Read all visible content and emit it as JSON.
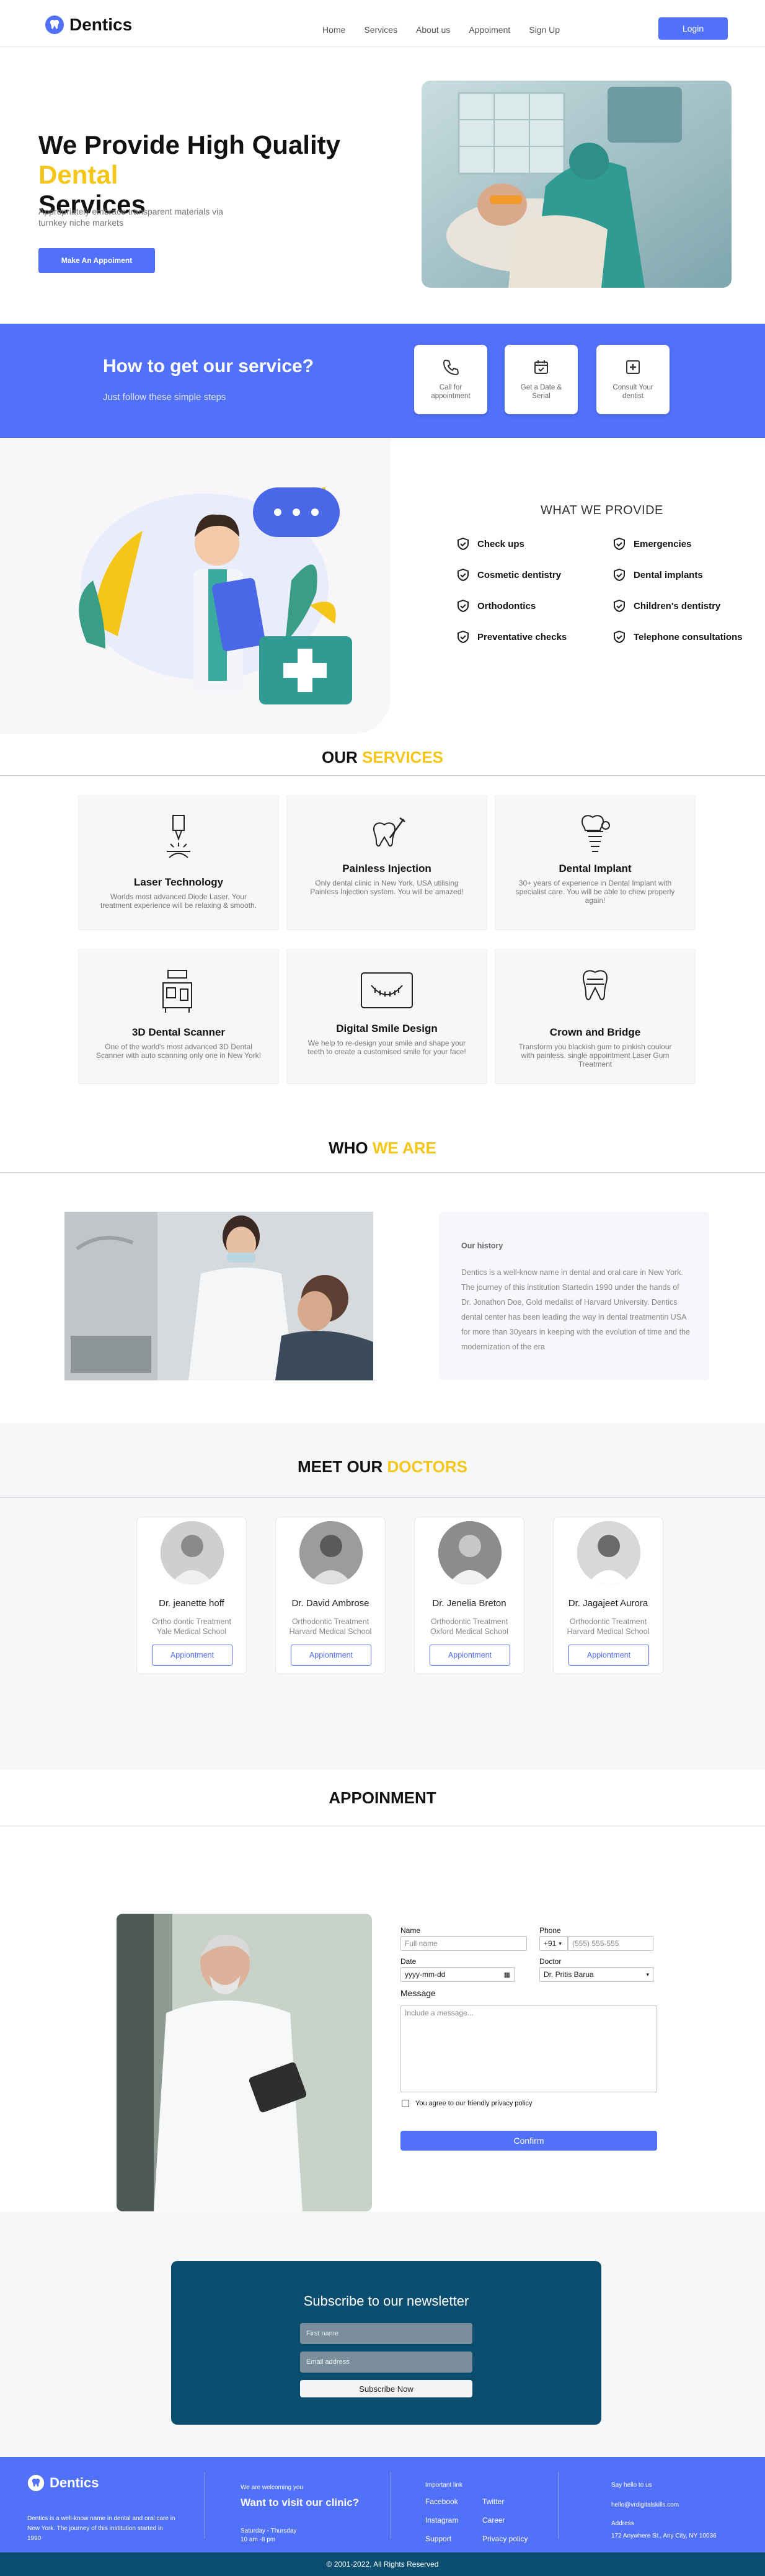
{
  "nav": {
    "brand": "Dentics",
    "links": [
      "Home",
      "Services",
      "About us",
      "Appoiment",
      "Sign Up"
    ],
    "login": "Login"
  },
  "hero": {
    "title_part1": "We Provide High Quality",
    "title_accent": "Dental",
    "title_part2": "Services",
    "subtitle": "Appropriately embrace transparent materials via turnkey niche markets",
    "button": "Make An Appoiment"
  },
  "how": {
    "title": "How to get our service?",
    "subtitle": "Just follow these simple steps",
    "steps": [
      "Call for appointment",
      "Get a Date & Serial",
      "Consult Your dentist"
    ]
  },
  "provide": {
    "title": "WHAT WE PROVIDE",
    "items": [
      "Check ups",
      "Emergencies",
      "Cosmetic dentistry",
      "Dental implants",
      "Orthodontics",
      "Children's dentistry",
      "Preventative checks",
      "Telephone consultations"
    ]
  },
  "services": {
    "heading": "OUR",
    "heading_accent": "SERVICES",
    "items": [
      {
        "title": "Laser Technology",
        "desc": "Worlds most advanced Diode Laser. Your treatment experience will be relaxing & smooth."
      },
      {
        "title": "Painless Injection",
        "desc": "Only dental clinic in New York, USA utilising Painless Injection system. You will be amazed!"
      },
      {
        "title": "Dental Implant",
        "desc": "30+ years of experience in Dental Implant with specialist care. You will be able to chew properly again!"
      },
      {
        "title": "3D Dental Scanner",
        "desc": "One of the world's most advanced 3D Dental Scanner with auto scanning only one in New York!"
      },
      {
        "title": "Digital Smile Design",
        "desc": "We help to re-design your smile and shape your teeth to create a customised smile for your face!"
      },
      {
        "title": "Crown and Bridge",
        "desc": "Transform you blackish gum to pinkish coulour with painless. single appointment Laser Gum Treatment"
      }
    ]
  },
  "who": {
    "heading": "WHO",
    "heading_accent": "WE ARE",
    "history_title": "Our history",
    "history_text": "Dentics is a well-know name in dental and oral care in New York. The journey of this institution Startedin 1990 under the hands of Dr. Jonathon Doe, Gold medalist of Harvard University. Dentics dental center has been leading the way in dental treatmentin USA for more than 30years in keeping with the evolution of time and the modernization of the era"
  },
  "doctors": {
    "heading": "MEET OUR",
    "heading_accent": "DOCTORS",
    "button": "Appiontment",
    "items": [
      {
        "name": "Dr. jeanette hoff",
        "role": "Ortho dontic Treatment Yale Medical School"
      },
      {
        "name": "Dr. David Ambrose",
        "role": "Orthodontic Treatment Harvard Medical School"
      },
      {
        "name": "Dr. Jenelia Breton",
        "role": "Orthodontic Treatment Oxford Medical School"
      },
      {
        "name": "Dr. Jagajeet Aurora",
        "role": "Orthodontic Treatment Harvard Medical School"
      }
    ]
  },
  "appointment": {
    "heading": "APPOINMENT",
    "name_label": "Name",
    "name_placeholder": "Full name",
    "phone_label": "Phone",
    "phone_code": "+91",
    "phone_placeholder": "(555) 555-555",
    "date_label": "Date",
    "date_placeholder": "yyyy-mm-dd",
    "doctor_label": "Doctor",
    "doctor_value": "Dr. Pritis Barua",
    "message_label": "Message",
    "message_placeholder": "Include a message...",
    "agree": "You agree to our friendly privacy policy",
    "confirm": "Confirm"
  },
  "newsletter": {
    "title": "Subscribe to our newsletter",
    "first_name": "First name",
    "email": "Email address",
    "button": "Subscribe Now"
  },
  "footer": {
    "brand": "Dentics",
    "about": "Dentics is a well-know name in dental and oral care in New York. The journey of this institution started in 1990",
    "welcome": "We are welcoming you",
    "visit_title": "Want to visit our clinic?",
    "hours_days": "Saturday - Thursday",
    "hours_time": "10 am -8 pm",
    "important_title": "Important link",
    "links": [
      "Facebook",
      "Twitter",
      "Instagram",
      "Career",
      "Support",
      "Privacy policy"
    ],
    "say_hello": "Say hello to us",
    "email": "hello@vrdigitalskills.com",
    "address_label": "Address",
    "address": "172 Anywhere St., Any City, NY 10036",
    "copyright": "© 2001-2022, All Rights Reserved"
  },
  "colors": {
    "primary": "#5171f8",
    "accent": "#f5c518",
    "dark": "#0b4d6e"
  }
}
